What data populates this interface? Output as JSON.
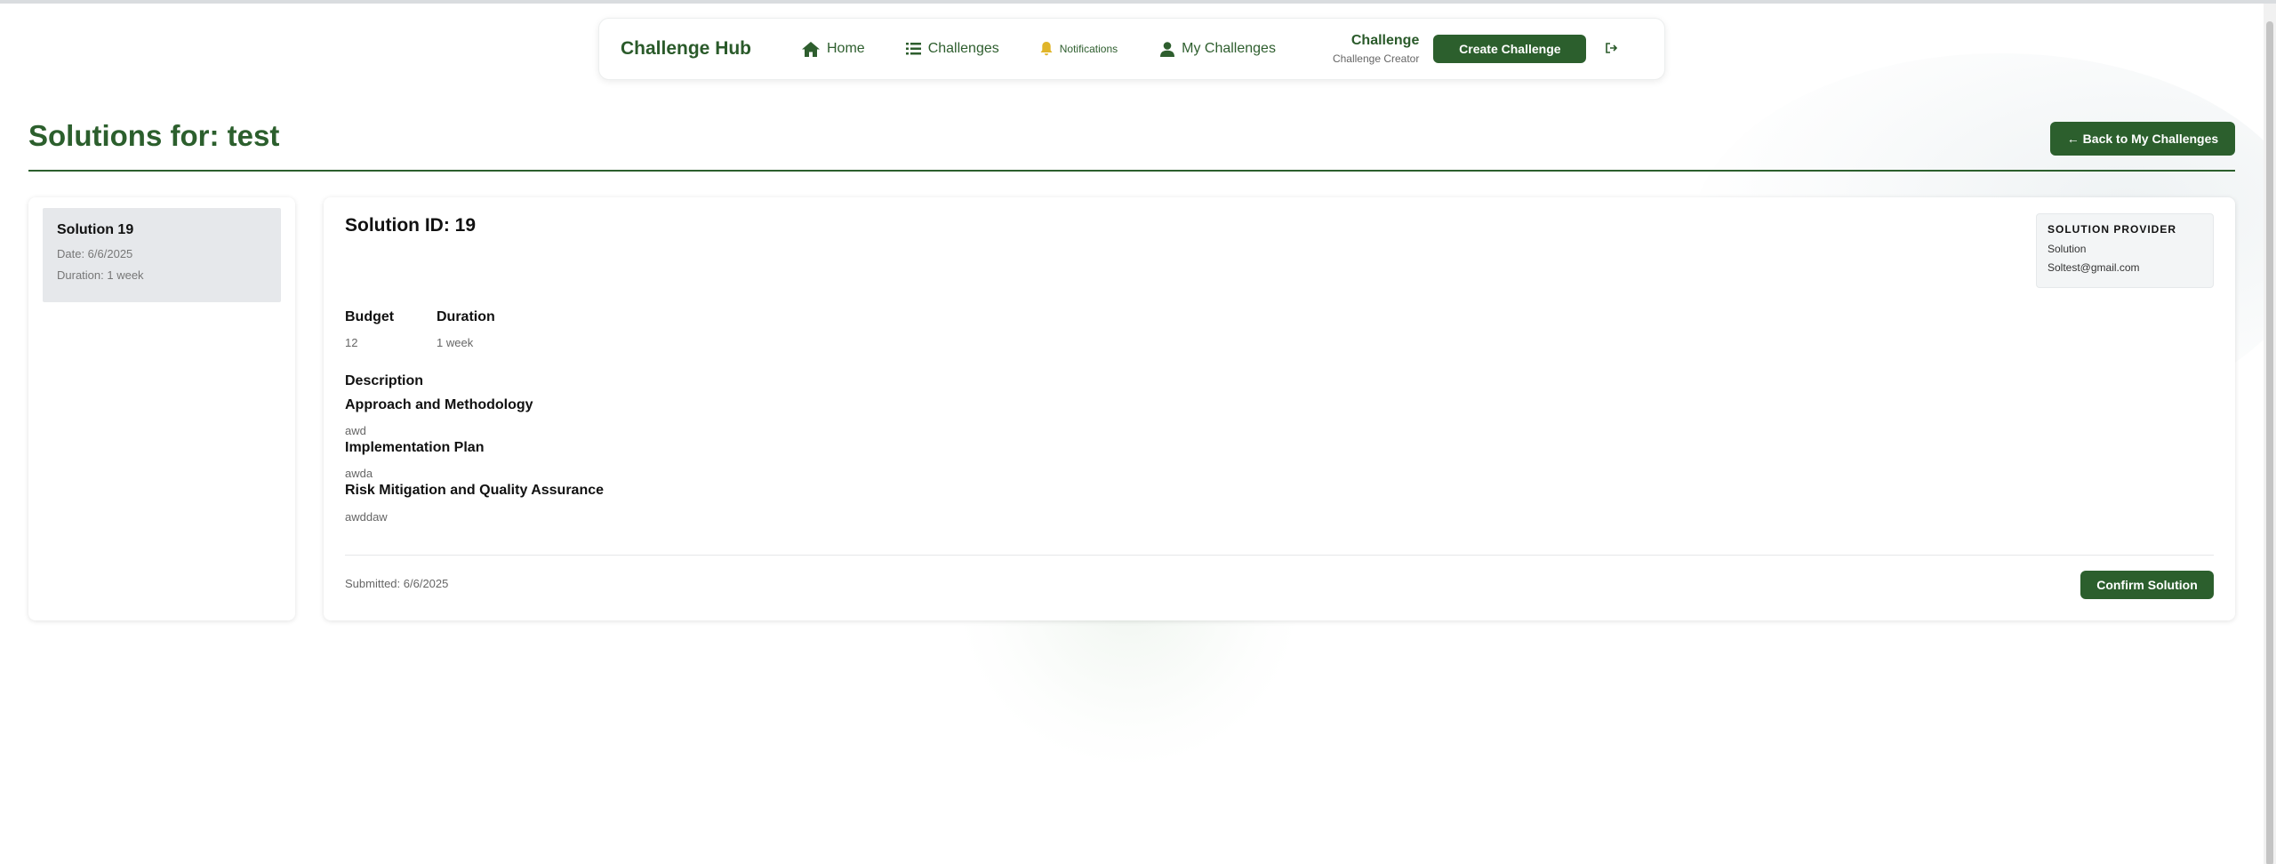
{
  "navbar": {
    "brand": "Challenge Hub",
    "items": [
      {
        "label": "Home",
        "icon": "home-icon"
      },
      {
        "label": "Challenges",
        "icon": "list-icon"
      },
      {
        "label": "Notifications",
        "icon": "bell-icon"
      },
      {
        "label": "My Challenges",
        "icon": "user-icon"
      }
    ],
    "user_name": "Challenge",
    "user_role": "Challenge Creator",
    "create_label": "Create Challenge",
    "logout_icon": "logout-icon"
  },
  "page": {
    "title": "Solutions for: test",
    "back_label": "← Back to My Challenges"
  },
  "sidebar": {
    "items": [
      {
        "title": "Solution 19",
        "date": "Date: 6/6/2025",
        "duration": "Duration: 1 week"
      }
    ]
  },
  "detail": {
    "title": "Solution ID: 19",
    "provider": {
      "label": "SOLUTION PROVIDER",
      "name": "Solution",
      "email": "Soltest@gmail.com"
    },
    "budget_label": "Budget",
    "budget_value": "12",
    "duration_label": "Duration",
    "duration_value": "1 week",
    "description_label": "Description",
    "sections": [
      {
        "heading": "Approach and Methodology",
        "text": "awd"
      },
      {
        "heading": "Implementation Plan",
        "text": "awda"
      },
      {
        "heading": "Risk Mitigation and Quality Assurance",
        "text": "awddaw"
      }
    ],
    "submitted": "Submitted: 6/6/2025",
    "confirm_label": "Confirm Solution"
  },
  "colors": {
    "primary": "#2c5f2d",
    "bell": "#e0b52a"
  }
}
